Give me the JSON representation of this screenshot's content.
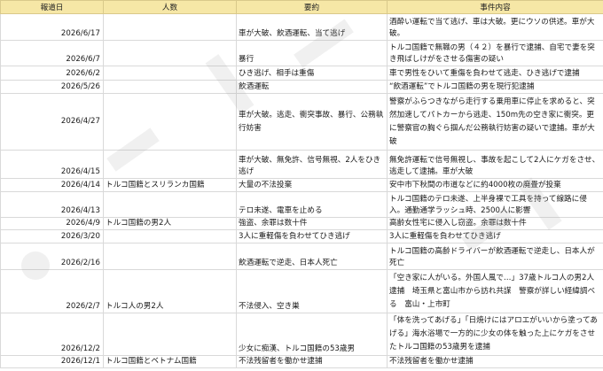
{
  "headers": [
    "報道日",
    "人数",
    "要約",
    "事件内容"
  ],
  "rows": [
    {
      "date": "2026/6/17",
      "people": "",
      "summary": "車が大破、飲酒運転、当て逃げ",
      "detail": "酒酔い運転で当て逃げ、車は大破。更にウソの供述。車が大破。"
    },
    {
      "date": "2026/6/7",
      "people": "",
      "summary": "暴行",
      "detail": "トルコ国籍で無職の男（４２）を暴行で逮捕、自宅で妻を突き飛ばしけがをさせる傷害の疑い"
    },
    {
      "date": "2026/6/2",
      "people": "",
      "summary": "ひき逃げ、相手は重傷",
      "detail": "車で男性をひいて重傷を負わせて逃走、ひき逃げで逮捕"
    },
    {
      "date": "2026/5/26",
      "people": "",
      "summary": "飲酒運転",
      "detail": "“飲酒運転”でトルコ国籍の男を現行犯逮捕"
    },
    {
      "date": "2026/4/27",
      "people": "",
      "summary": "車が大破。逃走、衝突事故、暴行、公務執行妨害",
      "detail": "警察がふらつきながら走行する乗用車に停止を求めると、突然加速してパトカーから逃走、150m先の空き家に衝突。更に警察官の胸ぐら掴んだ公務執行妨害の疑いで逮捕。車が大破"
    },
    {
      "date": "2026/4/15",
      "people": "",
      "summary": "車が大破、無免許、信号無視、2人をひき逃げ",
      "detail": "無免許運転で信号無視し、事故を起こして2人にケガをさせ、逃走して逮捕。車が大破"
    },
    {
      "date": "2026/4/14",
      "people": "トルコ国籍とスリランカ国籍",
      "summary": "大量の不法投棄",
      "detail": "安中市下秋間の市道などに約4000枚の廃畳が投棄"
    },
    {
      "date": "2026/4/13",
      "people": "",
      "summary": "テロ未遂、電車を止める",
      "detail": "トルコ国籍のテロ未遂、上半身裸で工具を持って線路に侵入。通勤通学ラッシュ時、2500人に影響"
    },
    {
      "date": "2026/4/9",
      "people": "トルコ国籍の男2人",
      "summary": "強盗、余罪は数十件",
      "detail": "高齢女性宅に侵入し窃盗。余罪は数十件"
    },
    {
      "date": "2026/3/20",
      "people": "",
      "summary": "3人に重軽傷を負わせてひき逃げ",
      "detail": "3人に重軽傷を負わせてひき逃げ"
    },
    {
      "date": "2026/2/16",
      "people": "",
      "summary": "飲酒運転で逆走、日本人死亡",
      "detail": "トルコ国籍の高齢ドライバーが飲酒運転で逆走し、日本人が死亡"
    },
    {
      "date": "2026/2/7",
      "people": "トルコ人の男2人",
      "summary": "不法侵入、空き巣",
      "detail": "「空き家に人がいる。外国人風で…」37歳トルコ人の男2人 逮捕　埼玉県と富山市から訪れ共謀　警察が詳しい経緯調べる　富山・上市町"
    },
    {
      "date": "2026/12/2",
      "people": "",
      "summary": "少女に痴漢、トルコ国籍の53歳男",
      "detail": "「体を洗ってあげる」「日焼けにはアロエがいいから塗ってあげる」海水浴場で一方的に少女の体を触った上にケガをさせたトルコ国籍の53歳男を逮捕"
    },
    {
      "date": "2026/12/1",
      "people": "トルコ国籍とベトナム国籍",
      "summary": "不法残留者を働かせ逮捕",
      "detail": "不法残留者を働かせ逮捕"
    }
  ]
}
